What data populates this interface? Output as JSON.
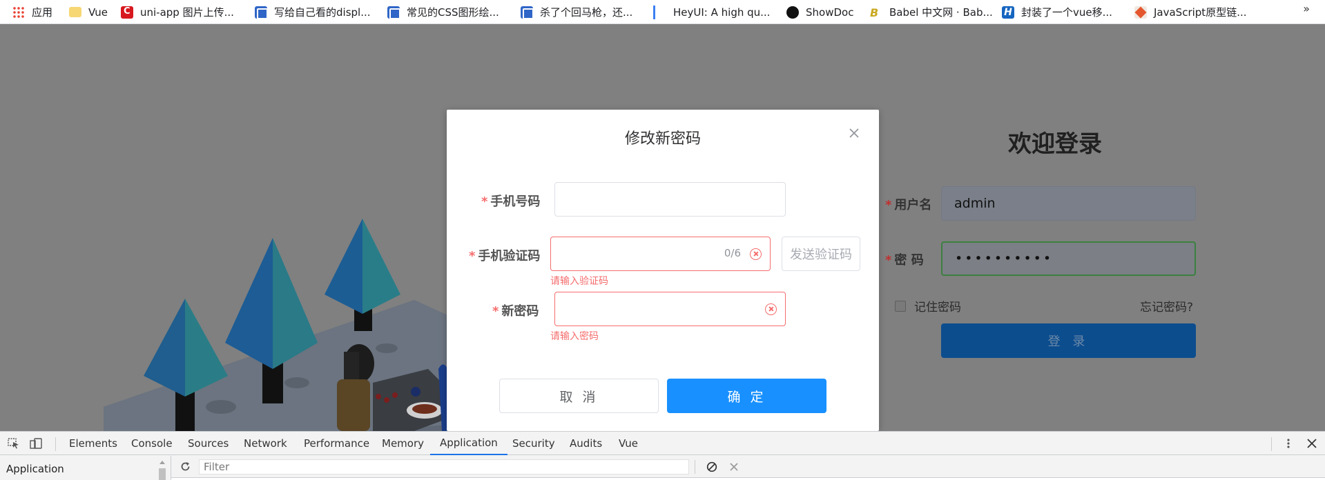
{
  "bookmarks": [
    {
      "label": "应用",
      "icon": "apps-grid-icon"
    },
    {
      "label": "Vue",
      "icon": "folder-icon"
    },
    {
      "label": "uni-app 图片上传...",
      "icon": "csdn-icon"
    },
    {
      "label": "写给自己看的displ...",
      "icon": "blog-icon"
    },
    {
      "label": "常见的CSS图形绘...",
      "icon": "blog-icon"
    },
    {
      "label": "杀了个回马枪，还...",
      "icon": "blog-icon"
    },
    {
      "label": "HeyUI: A high qu...",
      "icon": "heyui-icon"
    },
    {
      "label": "ShowDoc",
      "icon": "showdoc-icon"
    },
    {
      "label": "Babel 中文网 · Bab...",
      "icon": "babel-icon"
    },
    {
      "label": "封装了一个vue移...",
      "icon": "h-icon"
    },
    {
      "label": "JavaScript原型链...",
      "icon": "js-icon"
    }
  ],
  "bookmarks_more": "»",
  "login": {
    "title": "欢迎登录",
    "username_label": "用户名",
    "username_value": "admin",
    "password_label": "密 码",
    "password_value": "••••••••••",
    "remember_label": "记住密码",
    "forgot_label": "忘记密码?",
    "submit_label": "登 录",
    "required_mark": "*"
  },
  "modal": {
    "title": "修改新密码",
    "phone_label": "手机号码",
    "phone_value": "",
    "code_label": "手机验证码",
    "code_value": "",
    "code_counter": "0/6",
    "send_code_label": "发送验证码",
    "code_error": "请输入验证码",
    "new_password_label": "新密码",
    "new_password_value": "",
    "new_password_error": "请输入密码",
    "cancel_label": "取 消",
    "confirm_label": "确 定",
    "required_mark": "*"
  },
  "devtools": {
    "tabs": [
      "Elements",
      "Console",
      "Sources",
      "Network",
      "Performance",
      "Memory",
      "Application",
      "Security",
      "Audits",
      "Vue"
    ],
    "active_tab": "Application",
    "sidebar_title": "Application",
    "filter_placeholder": "Filter"
  },
  "colors": {
    "primary": "#1890ff",
    "error": "#f56c6c",
    "overlay": "#808080",
    "devtools_active": "#1a73e8"
  }
}
